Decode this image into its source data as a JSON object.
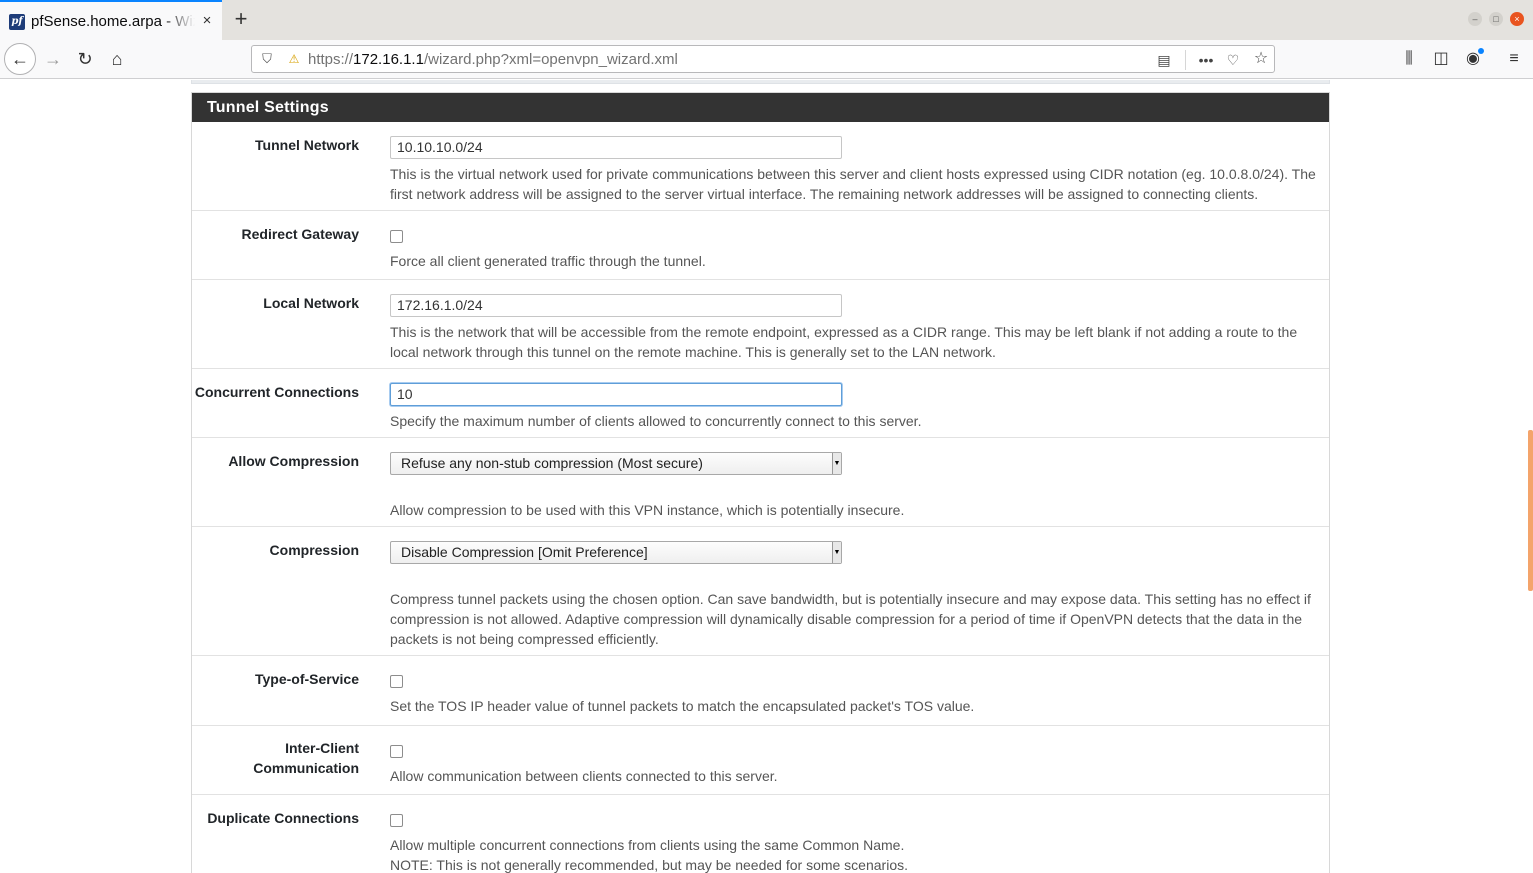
{
  "browser": {
    "tab_title": "pfSense.home.arpa - Wizard: OpenVPN Remote Access Server Setup",
    "tab_favicon_text": "pf",
    "url_prefix": "https://",
    "url_host": "172.16.1.1",
    "url_path": "/wizard.php?xml=openvpn_wizard.xml",
    "icons": {
      "back": "←",
      "forward": "→",
      "reload": "↻",
      "home": "⌂",
      "shield": "⛉",
      "lock": "⚠",
      "reader": "▤",
      "more": "•••",
      "pocket": "♡",
      "star": "☆",
      "library": "⫼",
      "sidebar": "◫",
      "account": "◉",
      "menu": "≡",
      "new_tab": "+",
      "close_tab": "×",
      "win_min": "–",
      "win_max": "□",
      "win_close": "×"
    }
  },
  "section": {
    "title": "Tunnel Settings",
    "fields": {
      "tunnel_network": {
        "label": "Tunnel Network",
        "value": "10.10.10.0/24",
        "help": "This is the virtual network used for private communications between this server and client hosts expressed using CIDR notation (eg. 10.0.8.0/24). The first network address will be assigned to the server virtual interface. The remaining network addresses will be assigned to connecting clients."
      },
      "redirect_gateway": {
        "label": "Redirect Gateway",
        "checked": false,
        "help": "Force all client generated traffic through the tunnel."
      },
      "local_network": {
        "label": "Local Network",
        "value": "172.16.1.0/24",
        "help": "This is the network that will be accessible from the remote endpoint, expressed as a CIDR range. This may be left blank if not adding a route to the local network through this tunnel on the remote machine. This is generally set to the LAN network."
      },
      "concurrent_connections": {
        "label": "Concurrent Connections",
        "value": "10",
        "help": "Specify the maximum number of clients allowed to concurrently connect to this server."
      },
      "allow_compression": {
        "label": "Allow Compression",
        "selected": "Refuse any non-stub compression (Most secure)",
        "help": "Allow compression to be used with this VPN instance, which is potentially insecure."
      },
      "compression": {
        "label": "Compression",
        "selected": "Disable Compression [Omit Preference]",
        "help": "Compress tunnel packets using the chosen option. Can save bandwidth, but is potentially insecure and may expose data. This setting has no effect if compression is not allowed. Adaptive compression will dynamically disable compression for a period of time if OpenVPN detects that the data in the packets is not being compressed efficiently."
      },
      "type_of_service": {
        "label": "Type-of-Service",
        "checked": false,
        "help": "Set the TOS IP header value of tunnel packets to match the encapsulated packet's TOS value."
      },
      "inter_client": {
        "label_line1": "Inter-Client",
        "label_line2": "Communication",
        "checked": false,
        "help": "Allow communication between clients connected to this server."
      },
      "duplicate_connections": {
        "label": "Duplicate Connections",
        "checked": false,
        "help_line1": "Allow multiple concurrent connections from clients using the same Common Name.",
        "help_line2": "NOTE: This is not generally recommended, but may be needed for some scenarios."
      }
    }
  }
}
